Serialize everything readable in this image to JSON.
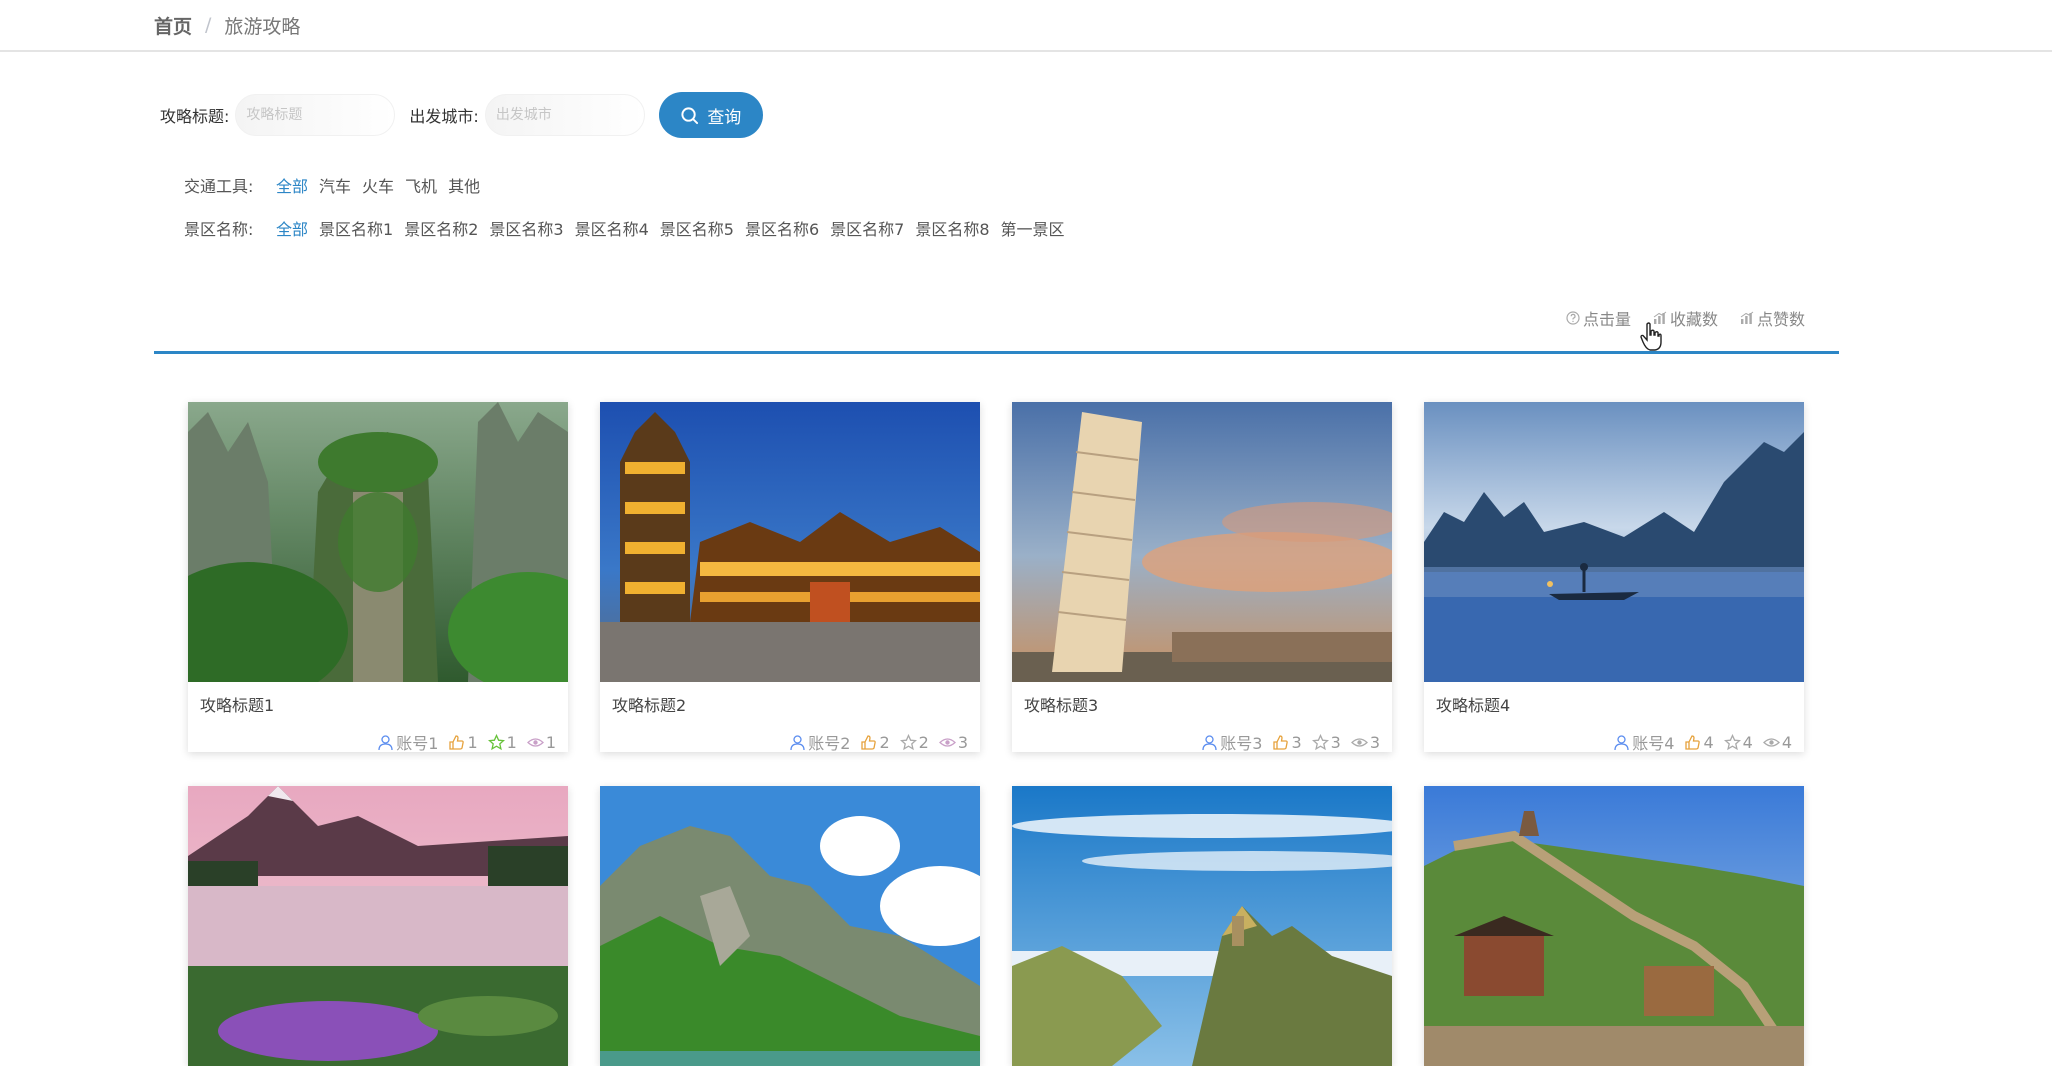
{
  "breadcrumb": {
    "home": "首页",
    "separator": "/",
    "current": "旅游攻略"
  },
  "search": {
    "title_label": "攻略标题:",
    "title_placeholder": "攻略标题",
    "city_label": "出发城市:",
    "city_placeholder": "出发城市",
    "query_button": "查询",
    "query_icon": "search-icon"
  },
  "filters": {
    "transport": {
      "label": "交通工具:",
      "options": [
        "全部",
        "汽车",
        "火车",
        "飞机",
        "其他"
      ],
      "active": "全部"
    },
    "scenic": {
      "label": "景区名称:",
      "options": [
        "全部",
        "景区名称1",
        "景区名称2",
        "景区名称3",
        "景区名称4",
        "景区名称5",
        "景区名称6",
        "景区名称7",
        "景区名称8",
        "第一景区"
      ],
      "active": "全部"
    }
  },
  "sort": [
    {
      "label": "点击量",
      "icon": "question-circle-icon"
    },
    {
      "label": "收藏数",
      "icon": "bar-chart-icon"
    },
    {
      "label": "点赞数",
      "icon": "bar-chart-icon"
    }
  ],
  "colors": {
    "accent": "#2c86c6",
    "like": "#e6a23c",
    "fav": "#67c23a",
    "view": "#c9a0c8",
    "user": "#5b8def"
  },
  "cards": [
    {
      "title": "攻略标题1",
      "account": "账号1",
      "likes": "1",
      "favorites": "1",
      "views": "1",
      "scene": "karst-peaks"
    },
    {
      "title": "攻略标题2",
      "account": "账号2",
      "likes": "2",
      "favorites": "2",
      "views": "3",
      "scene": "pagoda-night"
    },
    {
      "title": "攻略标题3",
      "account": "账号3",
      "likes": "3",
      "favorites": "3",
      "views": "3",
      "scene": "leaning-tower"
    },
    {
      "title": "攻略标题4",
      "account": "账号4",
      "likes": "4",
      "favorites": "4",
      "views": "4",
      "scene": "river-fisherman"
    },
    {
      "scene": "mountain-lake"
    },
    {
      "scene": "green-cliffs"
    },
    {
      "scene": "sea-of-clouds"
    },
    {
      "scene": "great-wall"
    }
  ]
}
